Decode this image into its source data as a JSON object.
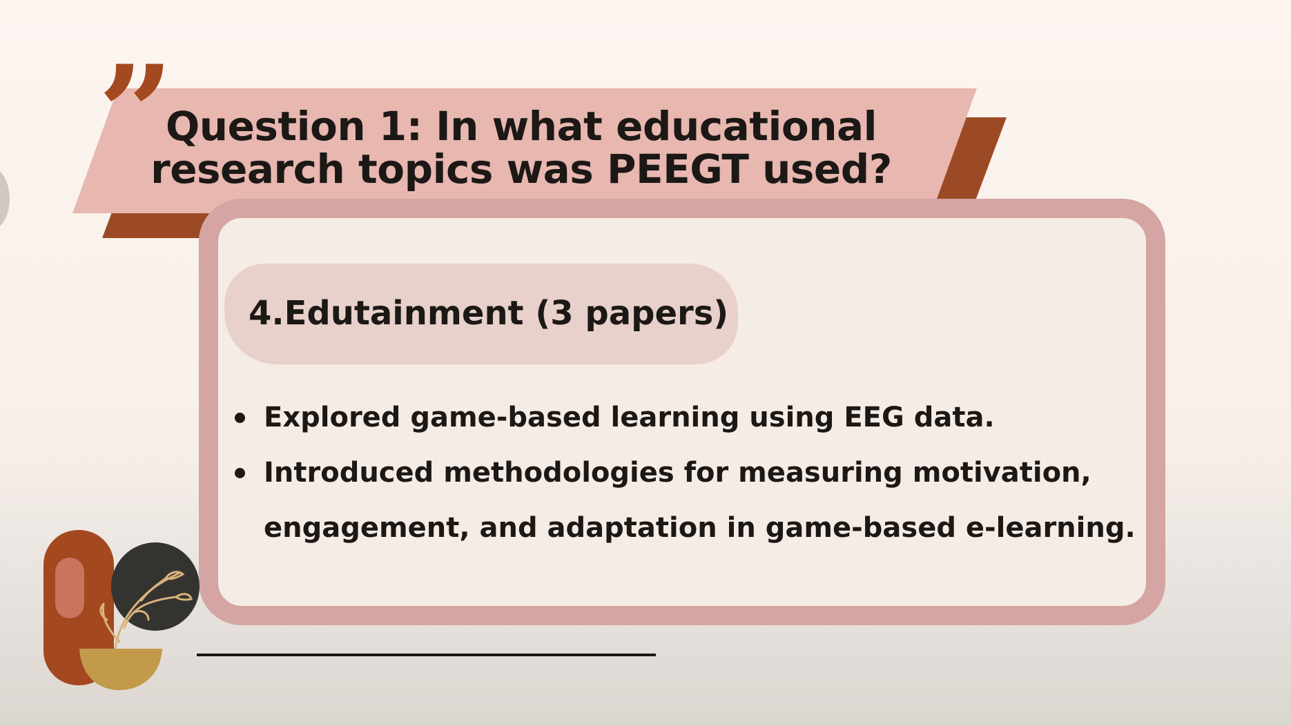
{
  "slide": {
    "title": "Question 1: In what educational research topics was PEEGT used?",
    "quote_glyph": "”",
    "section": {
      "subtitle": "4.Edutainment (3 papers)",
      "bullets": [
        "Explored game-based learning using EEG data.",
        "Introduced methodologies for measuring motivation, engagement, and adaptation in game-based e-learning."
      ]
    }
  },
  "colors": {
    "background": "#fcf5f0",
    "banner": "#e7b7b0",
    "banner_shadow": "#9c4a25",
    "card_border": "#d4a5a2",
    "card_fill": "#f5ece5",
    "subtitle_pill": "#e7d1ca",
    "text": "#1c1816",
    "accent_brown": "#a3481f",
    "plant_dark": "#333330",
    "pot_gold": "#c29a4a"
  },
  "icons": {
    "quote": "quote-mark-icon",
    "decoration": "potted-plant-icon"
  }
}
